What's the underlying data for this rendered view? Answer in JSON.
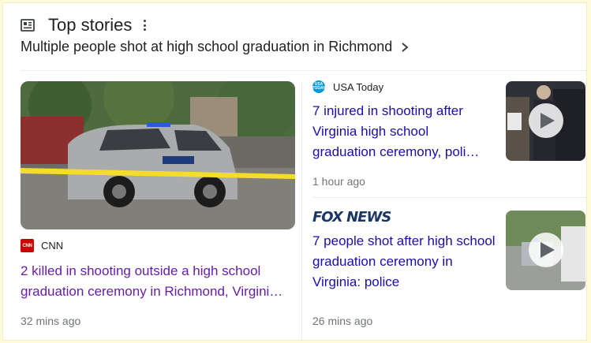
{
  "header": {
    "title": "Top stories",
    "icon": "newspaper-icon"
  },
  "topic": {
    "label": "Multiple people shot at high school graduation in Richmond"
  },
  "stories": [
    {
      "source": "CNN",
      "source_logo": "cnn-logo",
      "headline": "2 killed in shooting outside a high school graduation ceremony in Richmond, Virgini…",
      "time": "32 mins ago",
      "media": "image"
    },
    {
      "source": "USA Today",
      "source_logo": "usa-today-logo",
      "headline": "7 injured in shooting after Virginia high school graduation ceremony, poli…",
      "time": "1 hour ago",
      "media": "video"
    },
    {
      "source": "FOX NEWS",
      "source_logo": "fox-news-logo",
      "headline": "7 people shot after high school graduation ceremony in Virginia: police",
      "time": "26 mins ago",
      "media": "video"
    }
  ],
  "colors": {
    "link": "#1a0dab",
    "visited": "#681da8",
    "time": "#70757a",
    "page_bg": "#fffbd8"
  }
}
